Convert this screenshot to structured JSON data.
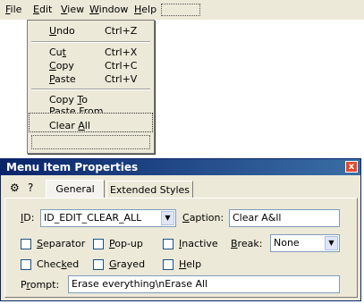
{
  "menubar": {
    "items": [
      {
        "label": "File",
        "mnemonic": "F",
        "rest": "ile"
      },
      {
        "label": "Edit",
        "mnemonic": "E",
        "rest": "dit"
      },
      {
        "label": "View",
        "mnemonic": "V",
        "rest": "iew"
      },
      {
        "label": "Window",
        "mnemonic": "W",
        "rest": "indow"
      },
      {
        "label": "Help",
        "mnemonic": "H",
        "rest": "elp"
      }
    ]
  },
  "edit_menu": {
    "items": [
      {
        "pre": "",
        "mn": "U",
        "post": "ndo",
        "shortcut": "Ctrl+Z"
      },
      {
        "pre": "Cu",
        "mn": "t",
        "post": "",
        "shortcut": "Ctrl+X"
      },
      {
        "pre": "",
        "mn": "C",
        "post": "opy",
        "shortcut": "Ctrl+C"
      },
      {
        "pre": "",
        "mn": "P",
        "post": "aste",
        "shortcut": "Ctrl+V"
      },
      {
        "pre": "Copy ",
        "mn": "T",
        "post": "o",
        "shortcut": ""
      },
      {
        "pre": "Paste From",
        "mn": "",
        "post": "",
        "shortcut": ""
      },
      {
        "pre": "Clear ",
        "mn": "A",
        "post": "ll",
        "shortcut": ""
      }
    ]
  },
  "props": {
    "title": "Menu Item Properties",
    "close": "x",
    "tabs": [
      "General",
      "Extended Styles"
    ],
    "pin_icon": "pushpin-icon",
    "help_icon": "question-mark-icon",
    "id_label": {
      "mn": "I",
      "rest": "D:"
    },
    "id_value": "ID_EDIT_CLEAR_ALL",
    "caption_label": {
      "mn": "C",
      "rest": "aption:"
    },
    "caption_value": "Clear A&ll",
    "break_label": {
      "mn": "B",
      "rest": "reak:"
    },
    "break_value": "None",
    "prompt_label": {
      "pre": "P",
      "mn": "r",
      "post": "ompt:"
    },
    "prompt_value": "Erase everything\\nErase All",
    "checkboxes": [
      {
        "pre": "",
        "mn": "S",
        "post": "eparator",
        "checked": false
      },
      {
        "pre": "",
        "mn": "P",
        "post": "op-up",
        "checked": false
      },
      {
        "pre": "",
        "mn": "I",
        "post": "nactive",
        "checked": false
      },
      {
        "pre": "Chec",
        "mn": "k",
        "post": "ed",
        "checked": false
      },
      {
        "pre": "",
        "mn": "G",
        "post": "rayed",
        "checked": false
      },
      {
        "pre": "",
        "mn": "H",
        "post": "elp",
        "checked": false
      }
    ]
  }
}
